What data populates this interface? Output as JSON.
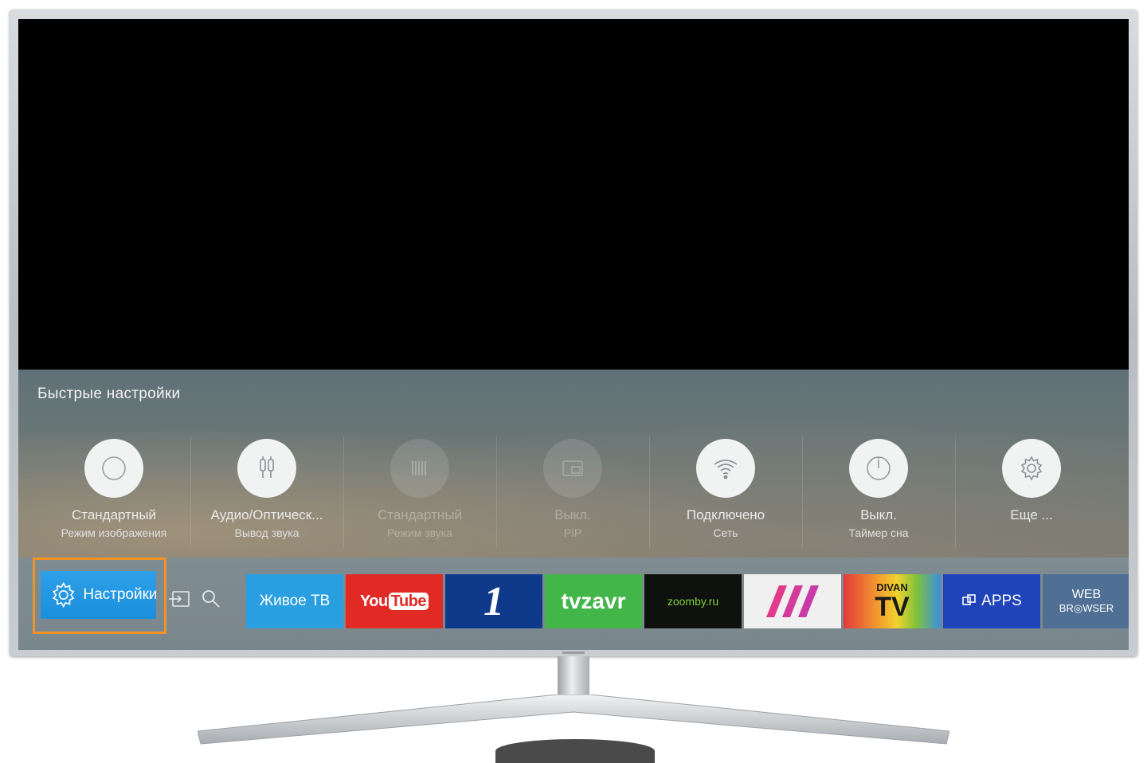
{
  "quick_settings": {
    "title": "Быстрые настройки",
    "items": [
      {
        "label": "Стандартный",
        "sub": "Режим изображения",
        "icon": "circle-icon",
        "enabled": true
      },
      {
        "label": "Аудио/Оптическ...",
        "sub": "Вывод звука",
        "icon": "audio-output-icon",
        "enabled": true
      },
      {
        "label": "Стандартный",
        "sub": "Режим звука",
        "icon": "equalizer-icon",
        "enabled": false
      },
      {
        "label": "Выкл.",
        "sub": "PIP",
        "icon": "pip-icon",
        "enabled": false
      },
      {
        "label": "Подключено",
        "sub": "Сеть",
        "icon": "wifi-icon",
        "enabled": true
      },
      {
        "label": "Выкл.",
        "sub": "Таймер сна",
        "icon": "timer-icon",
        "enabled": true
      },
      {
        "label": "Еще ...",
        "sub": "",
        "icon": "gear-icon",
        "enabled": true
      }
    ]
  },
  "bottom_bar": {
    "settings_label": "Настройки",
    "apps": [
      {
        "name": "Живое ТВ",
        "bg": "#2a9fe0",
        "color": "#ffffff"
      },
      {
        "name": "YouTube",
        "part1": "You",
        "part2": "Tube",
        "bg": "#e22a24",
        "color": "#ffffff"
      },
      {
        "name": "Первый канал",
        "glyph": "1",
        "bg": "#0f3a8c",
        "color": "#ffffff"
      },
      {
        "name": "tvzavr",
        "bg": "#43b64a",
        "color": "#ffffff"
      },
      {
        "name": "zoomby.ru",
        "bg": "#0e110e",
        "color": "#7fd13b"
      },
      {
        "name": "Пятница",
        "bg": "#f0f0f0",
        "color": "#e23a8a"
      },
      {
        "name": "DIVAN TV",
        "line1": "DIVAN",
        "line2": "TV",
        "bg": "#e2893a",
        "color": "#1a1a1a"
      },
      {
        "name": "APPS",
        "bg": "#1f43b8",
        "color": "#ffffff"
      },
      {
        "name": "WEB BROWSER",
        "line1": "WEB",
        "line2": "BR◎WSER",
        "bg": "#4f6f95",
        "color": "#ffffff"
      }
    ]
  },
  "colors": {
    "accent_blue": "#2ea0e8",
    "focus_orange": "#f39325"
  }
}
